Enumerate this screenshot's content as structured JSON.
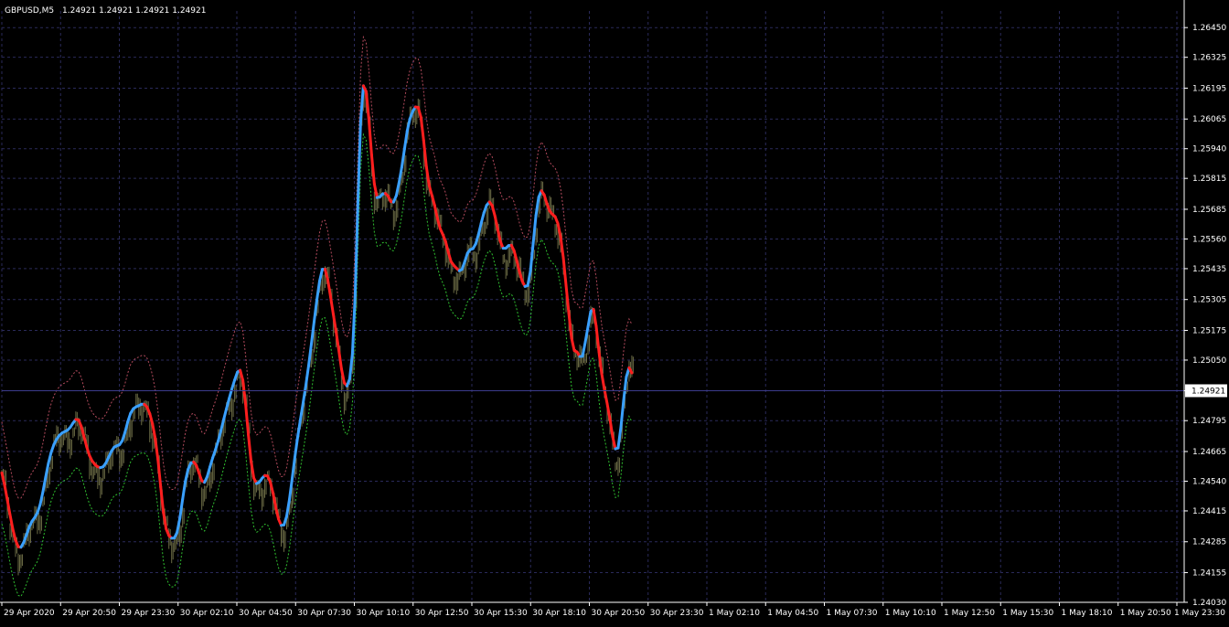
{
  "header": {
    "symbol": "GBPUSD,M5",
    "ohlc": "1.24921 1.24921 1.24921 1.24921"
  },
  "colors": {
    "background": "#000000",
    "grid": "#2a2a5a",
    "axis_text": "#ffffff",
    "bars": "#6b6b45",
    "up": "#3aa0ff",
    "down": "#ff1e1e",
    "upper_band": "#b24a5c",
    "lower_band": "#2fbf2f",
    "current_price_line": "#3c3c8c"
  },
  "chart_data": {
    "type": "line",
    "title": "GBPUSD,M5",
    "current_price": 1.24921,
    "current_price_label": "1.24921",
    "ylim": [
      1.2403,
      1.2652
    ],
    "yticks": [
      "1.26450",
      "1.26325",
      "1.26195",
      "1.26065",
      "1.25940",
      "1.25815",
      "1.25685",
      "1.25560",
      "1.25435",
      "1.25305",
      "1.25175",
      "1.25050",
      "1.24921",
      "1.24795",
      "1.24665",
      "1.24540",
      "1.24415",
      "1.24285",
      "1.24155",
      "1.24030"
    ],
    "xticks": [
      "29 Apr 2020",
      "29 Apr 20:50",
      "29 Apr 23:30",
      "30 Apr 02:10",
      "30 Apr 04:50",
      "30 Apr 07:30",
      "30 Apr 10:10",
      "30 Apr 12:50",
      "30 Apr 15:30",
      "30 Apr 18:10",
      "30 Apr 20:50",
      "30 Apr 23:30",
      "1 May 02:10",
      "1 May 04:50",
      "1 May 07:30",
      "1 May 10:10",
      "1 May 12:50",
      "1 May 15:30",
      "1 May 18:10",
      "1 May 20:50",
      "1 May 23:30"
    ],
    "grid": true,
    "x": [
      0,
      3,
      6,
      9,
      12,
      15,
      18,
      21,
      24,
      27,
      30,
      33,
      36,
      39,
      42,
      45,
      48,
      51,
      54,
      57,
      60,
      63,
      66,
      69,
      72,
      75,
      78,
      81,
      84,
      87,
      90,
      93,
      96,
      99,
      102,
      105,
      108,
      111,
      114,
      117,
      120,
      123,
      126,
      129,
      132,
      135,
      138,
      141,
      144,
      147,
      150,
      153,
      156,
      159,
      162,
      165,
      168,
      171,
      174,
      177,
      180,
      183,
      186,
      189,
      192,
      195,
      198,
      201,
      204,
      207,
      210,
      213,
      216,
      219,
      222,
      225,
      228,
      231,
      234,
      237,
      240,
      243,
      246,
      249,
      252,
      255,
      258,
      261,
      264,
      267,
      270,
      273,
      276,
      279,
      282,
      285,
      288,
      291,
      294,
      297,
      300,
      303,
      306,
      309,
      312,
      315,
      318,
      321,
      324,
      327,
      330,
      333,
      336,
      339,
      342,
      345,
      348,
      351,
      354,
      357,
      360,
      363,
      366,
      369,
      372,
      375,
      378,
      381,
      384,
      387,
      390,
      393,
      396,
      399,
      402,
      405,
      408,
      411,
      414,
      417,
      420,
      423,
      426,
      429,
      432,
      435,
      438,
      441,
      444,
      447,
      450,
      453,
      456,
      459,
      462,
      465,
      468,
      471,
      474,
      477,
      480,
      483,
      486,
      489,
      492,
      495,
      498,
      501,
      504,
      507,
      510,
      513,
      516,
      519,
      522,
      525,
      528,
      531,
      534,
      537,
      540,
      543,
      546,
      549,
      552,
      555,
      558,
      561,
      564,
      567,
      570,
      573,
      576,
      579,
      582,
      585,
      588,
      591,
      594,
      597,
      600,
      603,
      606,
      609,
      612,
      615,
      618,
      621,
      624,
      627,
      630,
      633,
      636,
      639,
      642,
      645,
      648,
      651,
      654,
      657,
      660,
      663,
      666,
      669,
      672,
      675,
      678,
      681,
      684,
      687,
      690,
      693,
      696,
      699,
      702,
      705,
      708,
      711,
      714,
      717,
      720,
      723,
      726,
      729,
      732,
      735,
      738,
      741,
      744,
      747,
      750,
      753,
      756,
      759,
      762,
      765,
      768,
      771,
      774,
      777,
      780,
      783,
      786,
      789,
      792,
      795,
      798,
      801,
      804,
      807,
      810,
      813,
      816,
      819,
      822,
      825,
      828,
      831,
      834,
      837,
      840,
      843,
      846,
      849,
      852,
      855,
      858,
      861,
      864,
      867,
      870,
      873,
      876,
      879,
      882,
      885,
      888,
      891,
      894,
      897,
      900,
      903,
      906,
      909,
      912,
      915,
      918,
      921,
      924,
      927,
      930,
      933,
      936,
      939,
      942,
      945,
      948,
      951,
      954,
      957,
      960,
      963,
      966,
      969,
      972,
      975,
      978,
      981,
      984,
      987,
      990,
      993,
      996,
      999,
      1002,
      1005,
      1008,
      1011,
      1014,
      1017,
      1020,
      1023,
      1026,
      1029,
      1032,
      1035,
      1038,
      1041,
      1044,
      1047,
      1050,
      1053,
      1056,
      1059,
      1062,
      1065,
      1068,
      1071,
      1074,
      1077,
      1080,
      1083,
      1086,
      1089,
      1092,
      1095,
      1098,
      1101,
      1104,
      1107,
      1110,
      1113,
      1116,
      1119,
      1122,
      1125,
      1128,
      1131,
      1134,
      1137,
      1140,
      1143,
      1146,
      1149,
      1152,
      1155,
      1158,
      1161,
      1164,
      1167,
      1170,
      1173,
      1176,
      1179,
      1182,
      1185,
      1188,
      1191,
      1194,
      1197,
      1200,
      1203,
      1206,
      1209,
      1212,
      1215,
      1218,
      1221,
      1224,
      1227,
      1230,
      1233,
      1236,
      1239,
      1242,
      1245,
      1248,
      1251,
      1254,
      1257,
      1260,
      1263,
      1266,
      1269,
      1272,
      1275,
      1278,
      1281,
      1284,
      1287,
      1290,
      1293
    ],
    "series": [
      {
        "values": [
          1.24575,
          1.24524,
          1.24462,
          1.24398,
          1.24339,
          1.24292,
          1.24264,
          1.24262,
          1.24283,
          1.24314,
          1.24347,
          1.24371,
          1.24387,
          1.24407,
          1.24442,
          1.24495,
          1.24557,
          1.24615,
          1.24661,
          1.24694,
          1.24717,
          1.24733,
          1.24743,
          1.24749,
          1.24755,
          1.24767,
          1.24785,
          1.248,
          1.24798,
          1.24771,
          1.24728,
          1.24684,
          1.24648,
          1.24625,
          1.2461,
          1.24601,
          1.24597,
          1.24601,
          1.24617,
          1.24641,
          1.24666,
          1.24683,
          1.24689,
          1.24694,
          1.24711,
          1.24747,
          1.24791,
          1.24826,
          1.24845,
          1.24853,
          1.24858,
          1.24864,
          1.24864,
          1.24853,
          1.24825,
          1.24782,
          1.2472,
          1.24631,
          1.24516,
          1.24408,
          1.24339,
          1.24311,
          1.243,
          1.24301,
          1.24325,
          1.24384,
          1.24464,
          1.24539,
          1.2459,
          1.24616,
          1.24621,
          1.24607,
          1.24574,
          1.24542,
          1.24535,
          1.2456,
          1.24601,
          1.24639,
          1.24673,
          1.2471,
          1.24753,
          1.248,
          1.24845,
          1.24888,
          1.24929,
          1.24966,
          1.24999,
          1.25007,
          1.24965,
          1.24865,
          1.24736,
          1.24623,
          1.24553,
          1.2453,
          1.24536,
          1.24552,
          1.24564,
          1.24562,
          1.24537,
          1.2449,
          1.24431,
          1.24381,
          1.24354,
          1.24356,
          1.24393,
          1.24463,
          1.24551,
          1.24642,
          1.24725,
          1.24799,
          1.2487,
          1.24944,
          1.25026,
          1.25117,
          1.25211,
          1.25302,
          1.25382,
          1.25432,
          1.25433,
          1.25388,
          1.25318,
          1.25244,
          1.25172,
          1.25094,
          1.25013,
          1.24955,
          1.24941,
          1.24971,
          1.25076,
          1.25325,
          1.25715,
          1.26056,
          1.26205,
          1.26181,
          1.26065,
          1.25915,
          1.25792,
          1.25734,
          1.25737,
          1.25749,
          1.25752,
          1.25741,
          1.25718,
          1.25715,
          1.25742,
          1.25796,
          1.25861,
          1.25938,
          1.26015,
          1.26066,
          1.26097,
          1.26116,
          1.26114,
          1.26073,
          1.25975,
          1.25864,
          1.25786,
          1.25744,
          1.25702,
          1.25648,
          1.25604,
          1.25579,
          1.2555,
          1.25504,
          1.25465,
          1.25449,
          1.25437,
          1.25426,
          1.25432,
          1.25464,
          1.255,
          1.25515,
          1.25519,
          1.25539,
          1.25578,
          1.25626,
          1.2567,
          1.25702,
          1.25716,
          1.25701,
          1.25658,
          1.25603,
          1.2555,
          1.25521,
          1.25521,
          1.25532,
          1.25534,
          1.25511,
          1.25469,
          1.25421,
          1.25382,
          1.2536,
          1.25364,
          1.25425,
          1.25542,
          1.25659,
          1.25736,
          1.25763,
          1.25746,
          1.25709,
          1.25678,
          1.25664,
          1.25654,
          1.25625,
          1.25568,
          1.25481,
          1.25364,
          1.25247,
          1.25143,
          1.2509,
          1.25084,
          1.25065,
          1.25066,
          1.25125,
          1.2519,
          1.25255,
          1.25264,
          1.25192,
          1.25085,
          1.24993,
          1.24926,
          1.24867,
          1.24802,
          1.24728,
          1.24676,
          1.2468,
          1.24766,
          1.2488,
          1.24979,
          1.25018,
          1.24996
        ]
      }
    ],
    "upper_band": {
      "values": [
        1.2479,
        1.24729,
        1.24667,
        1.24603,
        1.24542,
        1.24494,
        1.24469,
        1.24469,
        1.24488,
        1.2452,
        1.24554,
        1.24576,
        1.24592,
        1.24612,
        1.24647,
        1.247,
        1.24762,
        1.2482,
        1.24866,
        1.24899,
        1.24922,
        1.24938,
        1.24948,
        1.24954,
        1.2496,
        1.24972,
        1.2499,
        1.25005,
        1.25003,
        1.24976,
        1.24933,
        1.24889,
        1.24853,
        1.2483,
        1.24815,
        1.24806,
        1.24802,
        1.24806,
        1.24822,
        1.24846,
        1.24871,
        1.24888,
        1.24894,
        1.24899,
        1.24916,
        1.24952,
        1.24996,
        1.25031,
        1.2505,
        1.25058,
        1.25063,
        1.25069,
        1.25069,
        1.25058,
        1.2503,
        1.24987,
        1.24925,
        1.24836,
        1.24721,
        1.24613,
        1.24544,
        1.24516,
        1.24505,
        1.24506,
        1.2453,
        1.24589,
        1.24669,
        1.24744,
        1.24795,
        1.24821,
        1.24826,
        1.24812,
        1.24779,
        1.24747,
        1.2474,
        1.24765,
        1.24806,
        1.24844,
        1.24878,
        1.24915,
        1.24958,
        1.25005,
        1.2505,
        1.25093,
        1.25134,
        1.25171,
        1.25204,
        1.25212,
        1.2517,
        1.2507,
        1.24941,
        1.24828,
        1.24758,
        1.24735,
        1.24741,
        1.24757,
        1.24769,
        1.24767,
        1.24742,
        1.24695,
        1.24636,
        1.24586,
        1.24559,
        1.24561,
        1.24598,
        1.24668,
        1.24756,
        1.24847,
        1.2493,
        1.25004,
        1.25075,
        1.25149,
        1.25231,
        1.25322,
        1.25416,
        1.25507,
        1.25587,
        1.25637,
        1.25638,
        1.25593,
        1.25523,
        1.25449,
        1.25377,
        1.25299,
        1.25218,
        1.2516,
        1.25146,
        1.25176,
        1.25281,
        1.2553,
        1.2592,
        1.26261,
        1.2641,
        1.26386,
        1.2627,
        1.2612,
        1.25997,
        1.25939,
        1.25942,
        1.25954,
        1.25957,
        1.25946,
        1.25923,
        1.2592,
        1.25947,
        1.26001,
        1.26066,
        1.26143,
        1.2622,
        1.26271,
        1.26302,
        1.26321,
        1.26319,
        1.26278,
        1.2618,
        1.26069,
        1.25991,
        1.25949,
        1.25907,
        1.25853,
        1.25809,
        1.25784,
        1.25755,
        1.25709,
        1.2567,
        1.25654,
        1.25642,
        1.25631,
        1.25637,
        1.25669,
        1.25705,
        1.2572,
        1.25724,
        1.25744,
        1.25783,
        1.25831,
        1.25875,
        1.25907,
        1.25921,
        1.25906,
        1.25863,
        1.25808,
        1.25755,
        1.25726,
        1.25726,
        1.25737,
        1.25739,
        1.25716,
        1.25674,
        1.25626,
        1.25587,
        1.25565,
        1.25569,
        1.2563,
        1.25747,
        1.25864,
        1.25941,
        1.25968,
        1.25951,
        1.25914,
        1.25883,
        1.25869,
        1.25859,
        1.2583,
        1.25773,
        1.25686,
        1.25569,
        1.25452,
        1.25348,
        1.25295,
        1.25289,
        1.2527,
        1.25271,
        1.2533,
        1.25395,
        1.2546,
        1.25469,
        1.25397,
        1.2529,
        1.25198,
        1.25131,
        1.25072,
        1.25007,
        1.24933,
        1.24881,
        1.24885,
        1.24971,
        1.25085,
        1.25184,
        1.25223,
        1.25201
      ]
    },
    "lower_band": {
      "values": [
        1.2436,
        1.24319,
        1.24257,
        1.24193,
        1.24136,
        1.2409,
        1.24059,
        1.24055,
        1.24078,
        1.24108,
        1.2414,
        1.24166,
        1.24182,
        1.24202,
        1.24237,
        1.2429,
        1.24352,
        1.2441,
        1.24456,
        1.24489,
        1.24512,
        1.24528,
        1.24538,
        1.24544,
        1.2455,
        1.24562,
        1.2458,
        1.24595,
        1.24593,
        1.24566,
        1.24523,
        1.24479,
        1.24443,
        1.2442,
        1.24405,
        1.24396,
        1.24392,
        1.24396,
        1.24412,
        1.24436,
        1.24461,
        1.24478,
        1.24484,
        1.24489,
        1.24506,
        1.24542,
        1.24586,
        1.24621,
        1.2464,
        1.24648,
        1.24653,
        1.24659,
        1.24659,
        1.24648,
        1.2462,
        1.24577,
        1.24515,
        1.24426,
        1.24311,
        1.24203,
        1.24134,
        1.24106,
        1.24095,
        1.24096,
        1.2412,
        1.24179,
        1.24259,
        1.24334,
        1.24385,
        1.24411,
        1.24416,
        1.24402,
        1.24369,
        1.24337,
        1.2433,
        1.24355,
        1.24396,
        1.24434,
        1.24468,
        1.24505,
        1.24548,
        1.24595,
        1.2464,
        1.24683,
        1.24724,
        1.24761,
        1.24794,
        1.24802,
        1.2476,
        1.2466,
        1.24531,
        1.24418,
        1.24348,
        1.24325,
        1.24331,
        1.24347,
        1.24359,
        1.24357,
        1.24332,
        1.24285,
        1.24226,
        1.24176,
        1.24149,
        1.24151,
        1.24188,
        1.24258,
        1.24346,
        1.24437,
        1.2452,
        1.24594,
        1.24665,
        1.24739,
        1.24821,
        1.24912,
        1.25006,
        1.25097,
        1.25177,
        1.25227,
        1.25228,
        1.25183,
        1.25113,
        1.25039,
        1.24967,
        1.24889,
        1.24808,
        1.2475,
        1.24736,
        1.24766,
        1.24871,
        1.2512,
        1.2551,
        1.25851,
        1.26,
        1.25976,
        1.2586,
        1.2571,
        1.25587,
        1.25529,
        1.25532,
        1.25544,
        1.25547,
        1.25536,
        1.25513,
        1.2551,
        1.25537,
        1.25591,
        1.25656,
        1.25733,
        1.2581,
        1.25861,
        1.25892,
        1.25911,
        1.25909,
        1.25868,
        1.2577,
        1.25659,
        1.25581,
        1.25539,
        1.25497,
        1.25443,
        1.25399,
        1.25374,
        1.25345,
        1.25299,
        1.2526,
        1.25244,
        1.25232,
        1.25221,
        1.25227,
        1.25259,
        1.25295,
        1.2531,
        1.25314,
        1.25334,
        1.25373,
        1.25421,
        1.25465,
        1.25497,
        1.25511,
        1.25496,
        1.25453,
        1.25398,
        1.25345,
        1.25316,
        1.25316,
        1.25327,
        1.25329,
        1.25306,
        1.25264,
        1.25216,
        1.25177,
        1.25155,
        1.25159,
        1.2522,
        1.25337,
        1.25454,
        1.25531,
        1.25558,
        1.25541,
        1.25504,
        1.25473,
        1.25459,
        1.25449,
        1.2542,
        1.25363,
        1.25276,
        1.25159,
        1.25042,
        1.24938,
        1.24885,
        1.24879,
        1.2486,
        1.24861,
        1.2492,
        1.24985,
        1.2505,
        1.25059,
        1.24987,
        1.2488,
        1.24788,
        1.24721,
        1.24662,
        1.24597,
        1.24523,
        1.24471,
        1.24475,
        1.24561,
        1.24675,
        1.24774,
        1.24813,
        1.24791
      ]
    }
  }
}
